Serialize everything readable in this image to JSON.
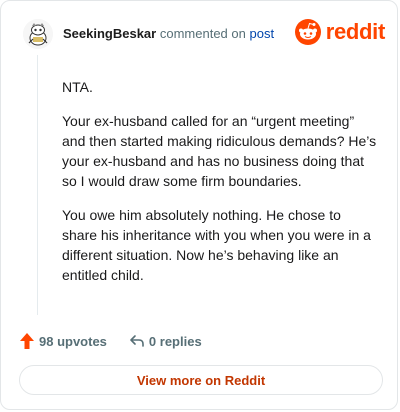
{
  "comment": {
    "author": "SeekingBeskar",
    "action_text": "commented on",
    "post_link_text": "post",
    "avatar_icon": "snoo-avatar-icon",
    "paragraphs": [
      "NTA.",
      "Your ex-husband called for an “urgent meeting” and then started making ridiculous demands? He’s your ex-husband and has no business doing that so I would draw some firm boundaries.",
      "You owe him absolutely nothing. He chose to share his inheritance with you when you were in a different situation. Now he’s behaving like an entitled child."
    ]
  },
  "brand": {
    "name": "reddit",
    "icon": "reddit-logo-icon",
    "color": "#ff4500"
  },
  "actions": {
    "upvotes_label": "98 upvotes",
    "upvote_icon": "upvote-arrow-icon",
    "upvote_color": "#ff4500",
    "replies_label": "0 replies",
    "reply_icon": "reply-arrow-icon"
  },
  "footer": {
    "view_more_label": "View more on Reddit",
    "link_color": "#c23600"
  }
}
